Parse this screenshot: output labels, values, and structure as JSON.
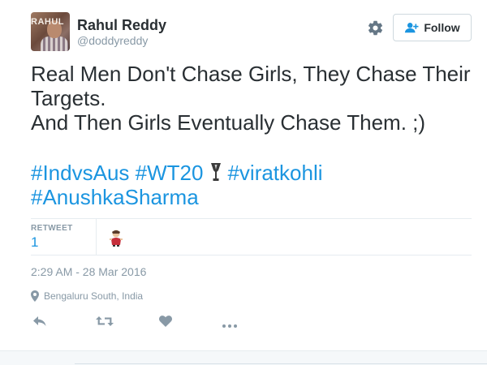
{
  "user": {
    "fullname": "Rahul Reddy",
    "username": "@doddyreddy",
    "avatar_text": "RAHUL"
  },
  "header": {
    "follow_label": "Follow",
    "gear_icon": "gear-icon",
    "follow_icon": "add-user-icon"
  },
  "tweet": {
    "lines": [
      "Real Men Don't Chase Girls, They Chase Their",
      "Targets.",
      "And Then Girls Eventually Chase Them. ;)"
    ],
    "hashtags": [
      "#IndvsAus",
      "#WT20",
      "#viratkohli",
      "#AnushkaSharma"
    ]
  },
  "stats": {
    "retweet_label": "RETWEET",
    "retweet_count": "1"
  },
  "meta": {
    "timestamp": "2:29 AM - 28 Mar 2016",
    "location": "Bengaluru South, India"
  },
  "actions": [
    "reply-icon",
    "retweet-icon",
    "like-icon",
    "more-icon"
  ],
  "colors": {
    "text": "#292f33",
    "muted": "#8899a6",
    "link": "#1b95e0",
    "border": "#e6ecf0"
  }
}
